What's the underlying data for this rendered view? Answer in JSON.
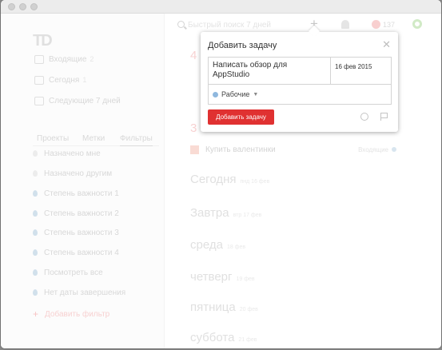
{
  "app": {
    "logo": "TD"
  },
  "sidebar": {
    "nav": [
      {
        "label": "Входящие",
        "count": "2"
      },
      {
        "label": "Сегодня",
        "count": "1"
      },
      {
        "label": "Следующие 7 дней",
        "count": ""
      }
    ],
    "tabs": [
      "Проекты",
      "Метки",
      "Фильтры"
    ],
    "filters": [
      "Назначено мне",
      "Назначено другим",
      "Степень важности 1",
      "Степень важности 2",
      "Степень важности 3",
      "Степень важности 4",
      "Посмотреть все",
      "Нет даты завершения"
    ],
    "add_filter": "Добавить фильтр"
  },
  "topbar": {
    "search_text": "Быстрый поиск 7 дней",
    "karma": "137"
  },
  "main": {
    "numbers": [
      "4",
      "3"
    ],
    "task": {
      "label": "Купить валентинки",
      "project": "Входящие"
    },
    "days": [
      {
        "name": "Сегодня",
        "date": "пнд 16 фев"
      },
      {
        "name": "Завтра",
        "date": "втр 17 фев"
      },
      {
        "name": "среда",
        "date": "18 фев"
      },
      {
        "name": "четверг",
        "date": "19 фев"
      },
      {
        "name": "пятница",
        "date": "20 фев"
      },
      {
        "name": "суббота",
        "date": "21 фев"
      }
    ]
  },
  "dialog": {
    "title": "Добавить задачу",
    "task_value": "Написать обзор для AppStudio",
    "date_value": "16 фев 2015",
    "project": "Рабочие",
    "submit_label": "Добавить задачу"
  },
  "colors": {
    "submit": "#e03131",
    "project_dot": "#8fb8de"
  }
}
